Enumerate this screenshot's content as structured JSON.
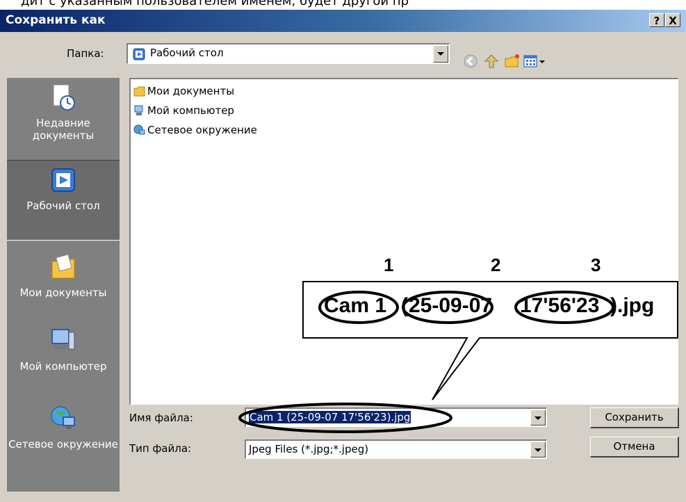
{
  "page": {
    "top_text": "дит с указанным пользователем именем, будет другой пр"
  },
  "window": {
    "title": "Сохранить как",
    "help_label": "?",
    "close_label": "X"
  },
  "folder": {
    "label": "Папка:",
    "value": "Рабочий стол"
  },
  "places": [
    {
      "label": "Недавние документы",
      "icon": "recent-documents-icon"
    },
    {
      "label": "Рабочий стол",
      "icon": "desktop-icon"
    },
    {
      "label": "Мои документы",
      "icon": "my-documents-icon"
    },
    {
      "label": "Мой компьютер",
      "icon": "my-computer-icon"
    },
    {
      "label": "Сетевое окружение",
      "icon": "network-icon"
    }
  ],
  "files": [
    {
      "label": "Мои документы",
      "icon": "my-documents-icon"
    },
    {
      "label": "Мой компьютер",
      "icon": "my-computer-icon"
    },
    {
      "label": "Сетевое окружение",
      "icon": "network-icon"
    }
  ],
  "filename": {
    "label": "Имя файла:",
    "value": "Cam 1 (25-09-07 17'56'23).jpg"
  },
  "filetype": {
    "label": "Тип файла:",
    "value": "Jpeg Files (*.jpg;*.jpeg)"
  },
  "buttons": {
    "save": "Сохранить",
    "cancel": "Отмена"
  },
  "callout": {
    "numbers": [
      "1",
      "2",
      "3"
    ],
    "parts": [
      "Cam 1",
      "(",
      "25-09-07",
      " ",
      "17'56'23",
      ").jpg"
    ]
  },
  "colors": {
    "titlebar_start": "#0a246a",
    "titlebar_end": "#a6caf0",
    "face": "#d4d0c8",
    "selection": "#0a246a"
  }
}
